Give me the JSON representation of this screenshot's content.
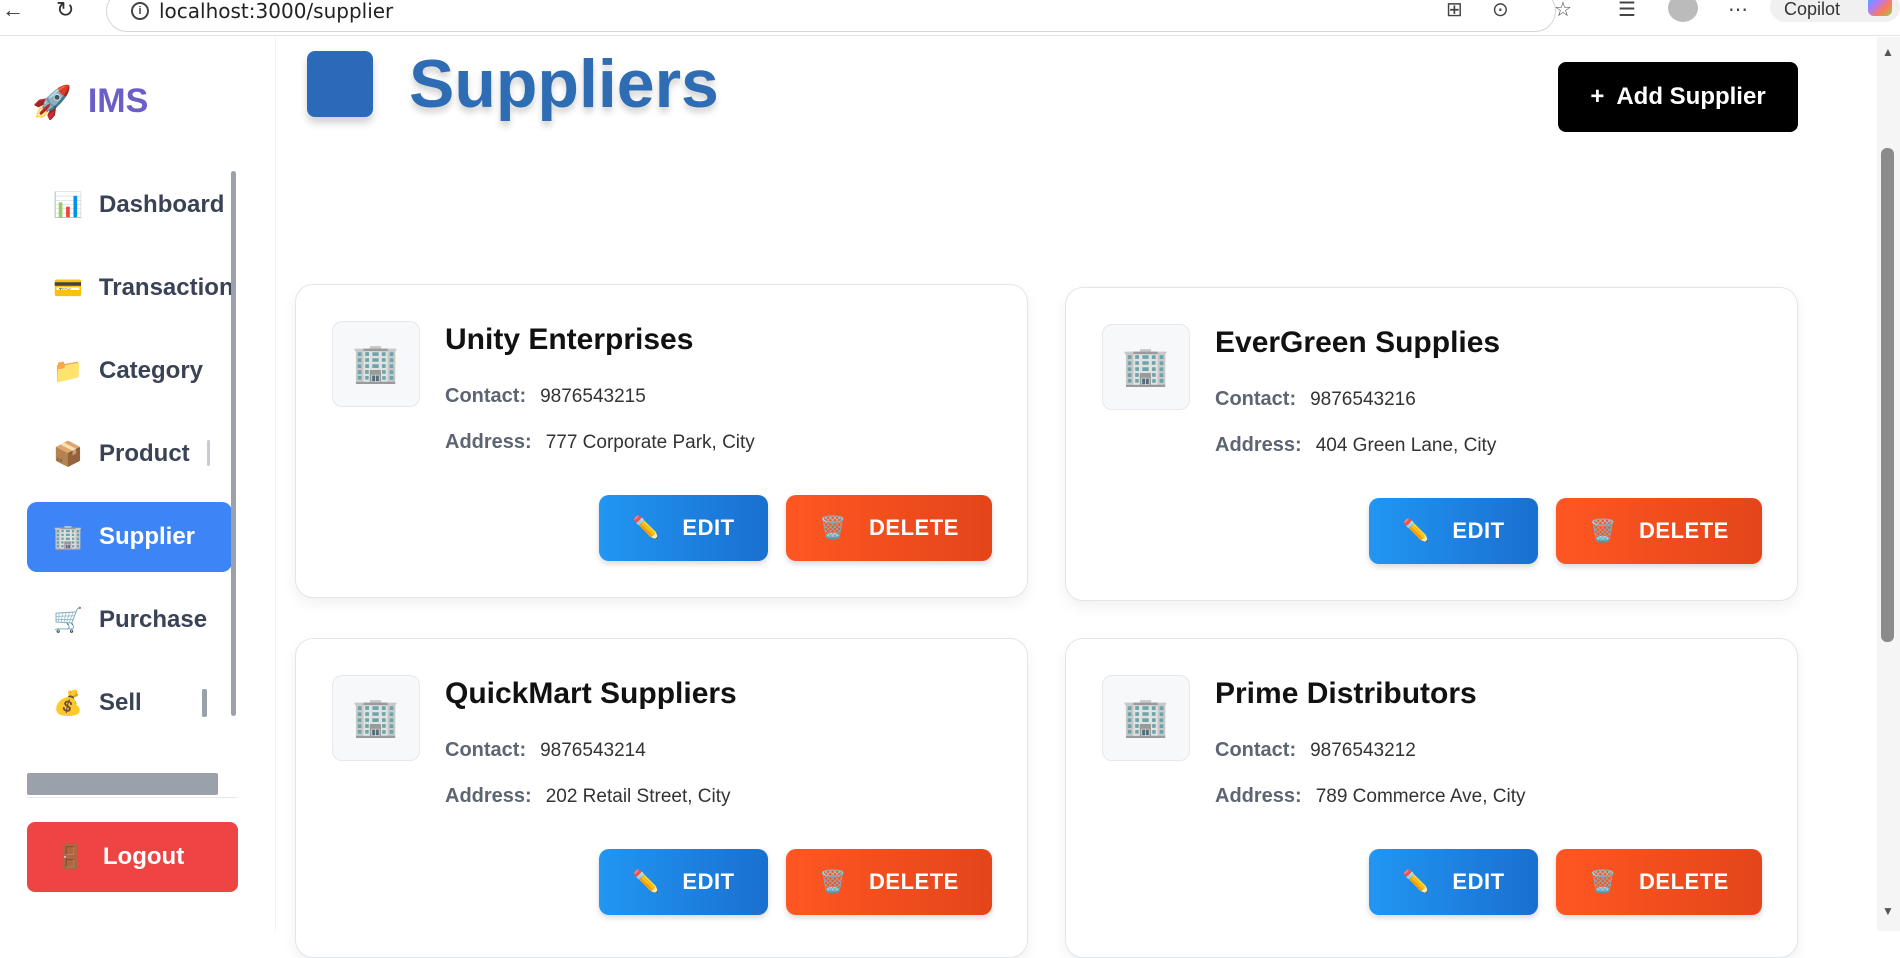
{
  "browser": {
    "url": "localhost:3000/supplier",
    "copilot_label": "Copilot"
  },
  "sidebar": {
    "brand_icon": "🚀",
    "brand_name": "IMS",
    "items": [
      {
        "icon": "📊",
        "label": "Dashboard"
      },
      {
        "icon": "💳",
        "label": "Transaction"
      },
      {
        "icon": "📁",
        "label": "Category"
      },
      {
        "icon": "📦",
        "label": "Product"
      },
      {
        "icon": "🏢",
        "label": "Supplier"
      },
      {
        "icon": "🛒",
        "label": "Purchase"
      },
      {
        "icon": "💰",
        "label": "Sell"
      }
    ],
    "logout": {
      "icon": "🚪",
      "label": "Logout"
    }
  },
  "main": {
    "title": "Suppliers",
    "add_button": {
      "icon": "+",
      "label": "Add Supplier"
    },
    "contact_label": "Contact:",
    "address_label": "Address:",
    "edit_label": "EDIT",
    "delete_label": "DELETE",
    "edit_icon": "✏️",
    "delete_icon": "🗑️",
    "supplier_icon": "🏢",
    "suppliers": [
      {
        "name": "Unity Enterprises",
        "contact": "9876543215",
        "address": "777 Corporate Park, City"
      },
      {
        "name": "EverGreen Supplies",
        "contact": "9876543216",
        "address": "404 Green Lane, City"
      },
      {
        "name": "QuickMart Suppliers",
        "contact": "9876543214",
        "address": "202 Retail Street, City"
      },
      {
        "name": "Prime Distributors",
        "contact": "9876543212",
        "address": "789 Commerce Ave, City"
      }
    ]
  },
  "colors": {
    "accent": "#3d84f7",
    "logout": "#ef4444",
    "edit": "#2196f3",
    "delete": "#ff5722",
    "title": "#2e6db3"
  }
}
